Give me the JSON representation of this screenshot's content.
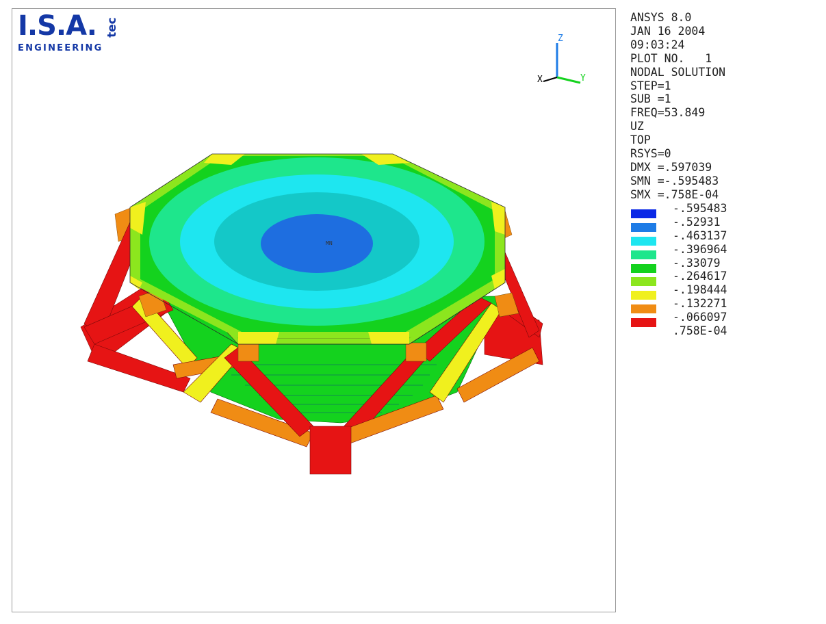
{
  "logo": {
    "main": "I.S.A.",
    "tec": "tec",
    "sub": "ENGINEERING"
  },
  "triad": {
    "x": "X",
    "y": "Y",
    "z": "Z"
  },
  "info": [
    "ANSYS 8.0",
    "JAN 16 2004",
    "09:03:24",
    "PLOT NO.   1",
    "NODAL SOLUTION",
    "STEP=1",
    "SUB =1",
    "FREQ=53.849",
    "UZ",
    "TOP",
    "RSYS=0",
    "DMX =.597039",
    "SMN =-.595483",
    "SMX =.758E-04"
  ],
  "legend": [
    {
      "value": "-.595483",
      "color": "#0a28e6"
    },
    {
      "value": "-.52931",
      "color": "#1e7ce6"
    },
    {
      "value": "-.463137",
      "color": "#1ee6f0"
    },
    {
      "value": "-.396964",
      "color": "#1ee68c"
    },
    {
      "value": "-.33079",
      "color": "#14d21e"
    },
    {
      "value": "-.264617",
      "color": "#8ce61e"
    },
    {
      "value": "-.198444",
      "color": "#f0f01e"
    },
    {
      "value": "-.132271",
      "color": "#f08c14"
    },
    {
      "value": "-.066097",
      "color": "#e61414"
    },
    {
      "value": ".758E-04",
      "color": null
    }
  ],
  "plot": {
    "min_marker": "MN"
  }
}
